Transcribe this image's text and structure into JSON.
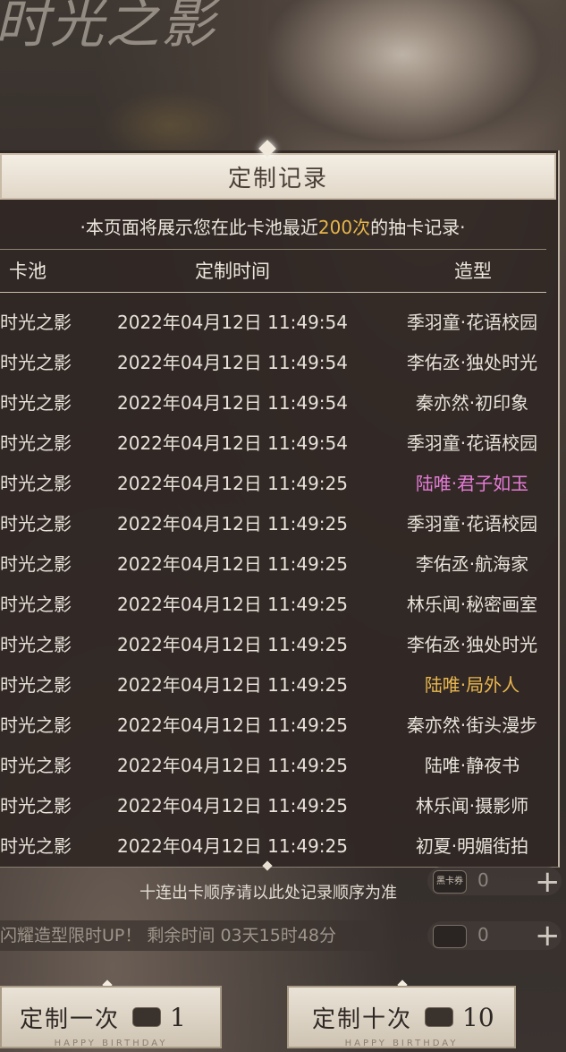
{
  "background": {
    "title_text": "时光之影"
  },
  "panel": {
    "title": "定制记录",
    "notice_prefix": "·本页面将展示您在此卡池最近",
    "notice_highlight": "200次",
    "notice_suffix": "的抽卡记录·",
    "headers": {
      "pool": "卡池",
      "time": "定制时间",
      "outfit": "造型"
    },
    "rows": [
      {
        "pool": "时光之影",
        "time": "2022年04月12日 11:49:54",
        "outfit": "季羽童·花语校园",
        "rarity": "normal"
      },
      {
        "pool": "时光之影",
        "time": "2022年04月12日 11:49:54",
        "outfit": "李佑丞·独处时光",
        "rarity": "normal"
      },
      {
        "pool": "时光之影",
        "time": "2022年04月12日 11:49:54",
        "outfit": "秦亦然·初印象",
        "rarity": "normal"
      },
      {
        "pool": "时光之影",
        "time": "2022年04月12日 11:49:54",
        "outfit": "季羽童·花语校园",
        "rarity": "normal"
      },
      {
        "pool": "时光之影",
        "time": "2022年04月12日 11:49:25",
        "outfit": "陆唯·君子如玉",
        "rarity": "pink"
      },
      {
        "pool": "时光之影",
        "time": "2022年04月12日 11:49:25",
        "outfit": "季羽童·花语校园",
        "rarity": "normal"
      },
      {
        "pool": "时光之影",
        "time": "2022年04月12日 11:49:25",
        "outfit": "李佑丞·航海家",
        "rarity": "normal"
      },
      {
        "pool": "时光之影",
        "time": "2022年04月12日 11:49:25",
        "outfit": "林乐闻·秘密画室",
        "rarity": "normal"
      },
      {
        "pool": "时光之影",
        "time": "2022年04月12日 11:49:25",
        "outfit": "李佑丞·独处时光",
        "rarity": "normal"
      },
      {
        "pool": "时光之影",
        "time": "2022年04月12日 11:49:25",
        "outfit": "陆唯·局外人",
        "rarity": "gold"
      },
      {
        "pool": "时光之影",
        "time": "2022年04月12日 11:49:25",
        "outfit": "秦亦然·街头漫步",
        "rarity": "normal"
      },
      {
        "pool": "时光之影",
        "time": "2022年04月12日 11:49:25",
        "outfit": "陆唯·静夜书",
        "rarity": "normal"
      },
      {
        "pool": "时光之影",
        "time": "2022年04月12日 11:49:25",
        "outfit": "林乐闻·摄影师",
        "rarity": "normal"
      },
      {
        "pool": "时光之影",
        "time": "2022年04月12日 11:49:25",
        "outfit": "初夏·明媚街拍",
        "rarity": "normal"
      }
    ],
    "footer_note": "十连出卡顺序请以此处记录顺序为准"
  },
  "banner": {
    "text": "闪耀造型限时UP！ 剩余时间 03天15时48分"
  },
  "resources": [
    {
      "icon_label": "黑卡券",
      "value": "0"
    },
    {
      "icon_label": "",
      "value": "0"
    }
  ],
  "buttons": {
    "single": {
      "label": "定制一次",
      "cost": "1",
      "sub": "HAPPY BIRTHDAY"
    },
    "ten": {
      "label": "定制十次",
      "cost": "10",
      "sub": "HAPPY BIRTHDAY"
    }
  },
  "colors": {
    "highlight": "#e6b54a",
    "pink": "#e57bd6",
    "gold": "#e8b64f"
  }
}
